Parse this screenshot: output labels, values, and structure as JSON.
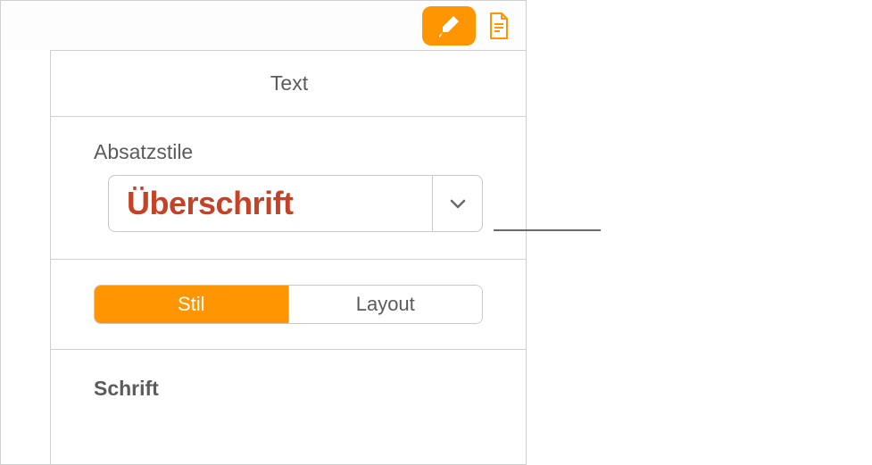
{
  "toolbar": {
    "format_icon": "paintbrush-icon",
    "document_icon": "document-icon"
  },
  "header": {
    "tab_text": "Text"
  },
  "paragraph_styles": {
    "label": "Absatzstile",
    "current_style": "Überschrift"
  },
  "sub_tabs": {
    "style": "Stil",
    "layout": "Layout"
  },
  "font_section": {
    "label": "Schrift"
  }
}
